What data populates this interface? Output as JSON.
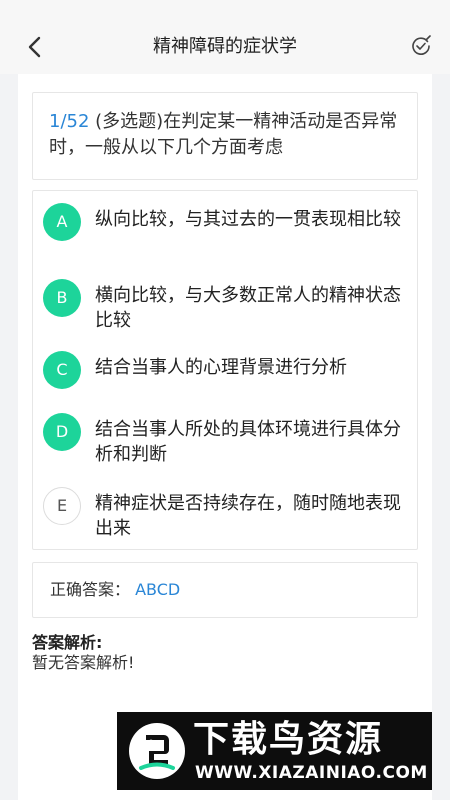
{
  "header": {
    "title": "精神障碍的症状学",
    "back_icon": "chevron-left-icon",
    "action_icon": "check-circle-edit-icon"
  },
  "question": {
    "index": "1/52",
    "text": "(多选题)在判定某一精神活动是否异常时，一般从以下几个方面考虑"
  },
  "options": [
    {
      "letter": "A",
      "text": "纵向比较，与其过去的一贯表现相比较",
      "correct": true
    },
    {
      "letter": "B",
      "text": "横向比较，与大多数正常人的精神状态比较",
      "correct": true
    },
    {
      "letter": "C",
      "text": "结合当事人的心理背景进行分析",
      "correct": true
    },
    {
      "letter": "D",
      "text": "结合当事人所处的具体环境进行具体分析和判断",
      "correct": true
    },
    {
      "letter": "E",
      "text": "精神症状是否持续存在，随时随地表现出来",
      "correct": false
    }
  ],
  "answer": {
    "label": "正确答案：",
    "value": "ABCD"
  },
  "analysis": {
    "title": "答案解析:",
    "text": "暂无答案解析!"
  },
  "watermark": {
    "title": "下载鸟资源",
    "url": "WWW.XIAZAINIAO.COM"
  },
  "colors": {
    "correct_option": "#1dd49a",
    "accent_blue": "#2a86d6",
    "header_bg": "#f7f7f7",
    "page_bg": "#f2f3f5"
  }
}
